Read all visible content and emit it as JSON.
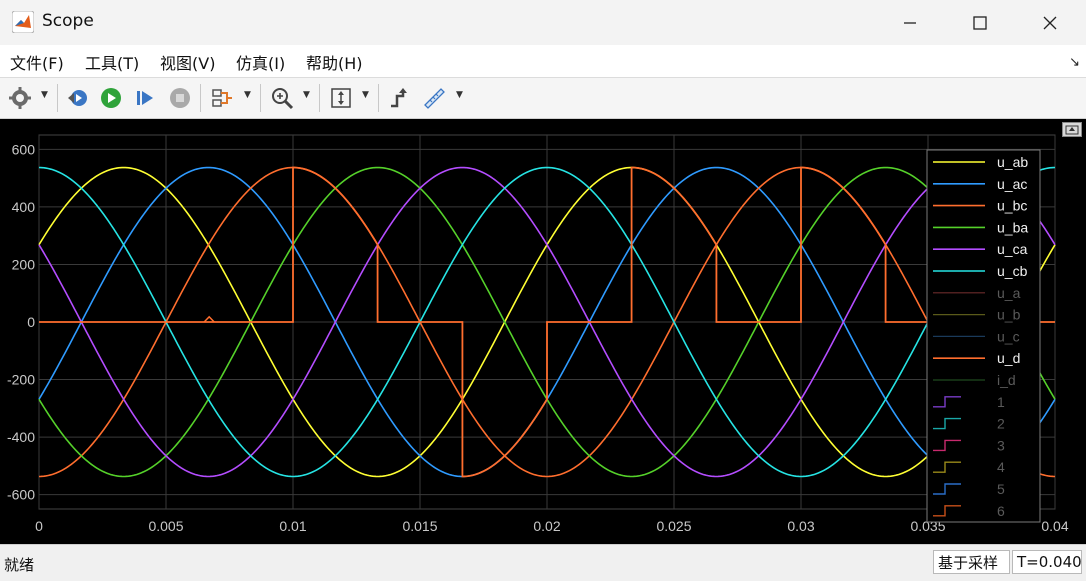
{
  "window": {
    "title": "Scope"
  },
  "menu": [
    "文件(F)",
    "工具(T)",
    "视图(V)",
    "仿真(I)",
    "帮助(H)"
  ],
  "toolbar": [
    "settings-icon",
    "rewind-icon",
    "run-icon",
    "step-forward-icon",
    "stop-icon",
    "signal-select-icon",
    "zoom-icon",
    "autoscale-icon",
    "highlight-icon",
    "measure-icon"
  ],
  "status": {
    "text": "就绪",
    "mode": "基于采样",
    "time": "T=0.040"
  },
  "colors": {
    "u_ab": "#ffff33",
    "u_ac": "#2f9bff",
    "u_bc": "#ff6e2e",
    "u_ba": "#55d12a",
    "u_ca": "#b44dff",
    "u_cb": "#26e4e4",
    "u_d": "#ff6e2e"
  },
  "chart_data": {
    "type": "line",
    "xlim": [
      0,
      0.04
    ],
    "ylim": [
      -650,
      650
    ],
    "xticks": [
      "0",
      "0.005",
      "0.01",
      "0.015",
      "0.02",
      "0.025",
      "0.03",
      "0.035",
      "0.04"
    ],
    "yticks": [
      "600",
      "400",
      "200",
      "0",
      "-200",
      "-400",
      "-600"
    ],
    "grid": true,
    "legend_position": "right",
    "legend": [
      {
        "name": "u_ab",
        "color": "#ffff33",
        "dim": false
      },
      {
        "name": "u_ac",
        "color": "#2f9bff",
        "dim": false
      },
      {
        "name": "u_bc",
        "color": "#ff6e2e",
        "dim": false
      },
      {
        "name": "u_ba",
        "color": "#55d12a",
        "dim": false
      },
      {
        "name": "u_ca",
        "color": "#b44dff",
        "dim": false
      },
      {
        "name": "u_cb",
        "color": "#26e4e4",
        "dim": false
      },
      {
        "name": "u_a",
        "color": "#6b2a2a",
        "dim": true
      },
      {
        "name": "u_b",
        "color": "#5a5a1a",
        "dim": true
      },
      {
        "name": "u_c",
        "color": "#1a3a5a",
        "dim": true
      },
      {
        "name": "u_d",
        "color": "#ff6e2e",
        "dim": false
      },
      {
        "name": "i_d",
        "color": "#1f4a1f",
        "dim": true
      },
      {
        "name": "1",
        "color": "#7a3cc8",
        "dim": true
      },
      {
        "name": "2",
        "color": "#1aa8a8",
        "dim": true
      },
      {
        "name": "3",
        "color": "#c82a6e",
        "dim": true
      },
      {
        "name": "4",
        "color": "#9a8a1a",
        "dim": true
      },
      {
        "name": "5",
        "color": "#2a6ec8",
        "dim": true
      },
      {
        "name": "6",
        "color": "#c8501a",
        "dim": true
      }
    ],
    "series": [
      {
        "name": "u_ab",
        "amplitude": 537,
        "frequency_hz": 50,
        "phase_deg": 30
      },
      {
        "name": "u_ac",
        "amplitude": 537,
        "frequency_hz": 50,
        "phase_deg": -30
      },
      {
        "name": "u_bc",
        "amplitude": 537,
        "frequency_hz": 50,
        "phase_deg": -90
      },
      {
        "name": "u_ba",
        "amplitude": 537,
        "frequency_hz": 50,
        "phase_deg": -150
      },
      {
        "name": "u_ca",
        "amplitude": 537,
        "frequency_hz": 50,
        "phase_deg": 150
      },
      {
        "name": "u_cb",
        "amplitude": 537,
        "frequency_hz": 50,
        "phase_deg": 90
      }
    ],
    "u_d_segments": [
      {
        "x0": 0.0,
        "x1": 0.01,
        "kind": "zero"
      },
      {
        "x0": 0.01,
        "x1": 0.01333,
        "kind": "follow",
        "series": "u_bc"
      },
      {
        "x0": 0.01333,
        "x1": 0.01667,
        "kind": "zero"
      },
      {
        "x0": 0.01667,
        "x1": 0.02,
        "kind": "follow",
        "series": "u_ac"
      },
      {
        "x0": 0.02,
        "x1": 0.02333,
        "kind": "zero"
      },
      {
        "x0": 0.02333,
        "x1": 0.02667,
        "kind": "follow",
        "series": "u_ab"
      },
      {
        "x0": 0.02667,
        "x1": 0.03,
        "kind": "zero"
      },
      {
        "x0": 0.03,
        "x1": 0.03333,
        "kind": "follow",
        "series": "u_bc"
      },
      {
        "x0": 0.03333,
        "x1": 0.04,
        "kind": "zero"
      }
    ],
    "u_d_jumps": [
      0.01,
      0.01333,
      0.01667,
      0.02333,
      0.02667,
      0.03,
      0.03333
    ]
  }
}
